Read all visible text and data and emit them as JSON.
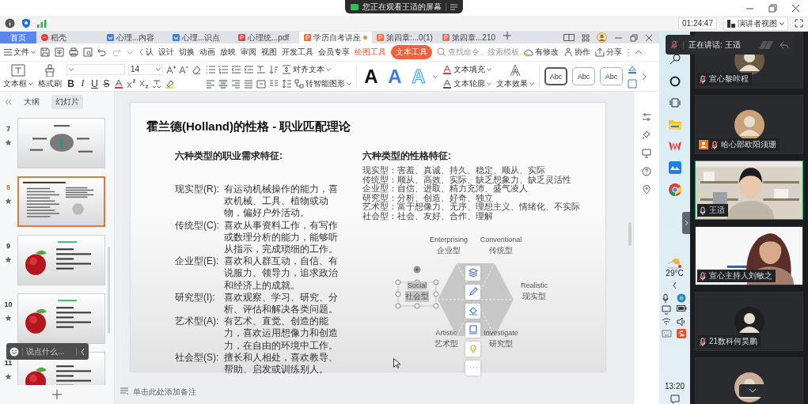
{
  "screen_share": {
    "notice": "您正在观看王适的屏幕"
  },
  "meeting_bar": {
    "timer": "01:24:47",
    "view_mode": "演讲者视图"
  },
  "wps": {
    "tabs": [
      {
        "label": "首页",
        "kind": "home",
        "selected": false,
        "modified": false
      },
      {
        "label": "稻壳",
        "kind": "docer",
        "selected": false,
        "modified": false
      },
      {
        "label": "心理...内容",
        "kind": "doc",
        "selected": false,
        "modified": false
      },
      {
        "label": "心理...识点",
        "kind": "doc",
        "selected": false,
        "modified": false
      },
      {
        "label": "心理统...pdf",
        "kind": "pdf",
        "selected": false,
        "modified": false
      },
      {
        "label": "学历自考讲座",
        "kind": "ppt",
        "selected": true,
        "modified": true
      },
      {
        "label": "第四章:...0(1)",
        "kind": "ppt",
        "selected": false,
        "modified": false
      },
      {
        "label": "第四章...210",
        "kind": "ppt",
        "selected": false,
        "modified": false
      }
    ],
    "menu": {
      "file": "文件",
      "scrolled_item": "认",
      "items": [
        "设计",
        "切换",
        "动画",
        "放映",
        "审阅",
        "视图",
        "开发工具",
        "会员专享"
      ],
      "tool_tabs": [
        {
          "label": "绘图工具",
          "selected": false
        },
        {
          "label": "文本工具",
          "selected": true
        }
      ],
      "search_placeholder": "查找命令、搜索模板",
      "actions": [
        {
          "label": "有修改",
          "kind": "cloud"
        },
        {
          "label": "协作",
          "kind": "collab"
        },
        {
          "label": "分享",
          "kind": "share"
        }
      ]
    },
    "ribbon": {
      "text_box": "文本框",
      "format_painter": "格式刷",
      "font_size": "14",
      "format_buttons": [
        {
          "label": "B",
          "kind": "bold"
        },
        {
          "label": "I",
          "kind": "italic"
        },
        {
          "label": "U",
          "kind": "underline"
        },
        {
          "label": "S",
          "kind": "strike"
        }
      ],
      "align_text": "对齐文本",
      "smart_art": "转智能图形",
      "art_letters": [
        {
          "letter": "A",
          "kind": "black"
        },
        {
          "letter": "A",
          "kind": "blue"
        },
        {
          "letter": "A",
          "kind": "outline"
        }
      ],
      "text_fill": "文本填充",
      "text_outline": "文本轮廓",
      "text_effect": "文本效果",
      "styles": [
        {
          "label": "Abc",
          "selected": true
        },
        {
          "label": "Abc",
          "selected": false
        },
        {
          "label": "Abc",
          "selected": false
        }
      ]
    },
    "slide_panel": {
      "tabs": [
        {
          "label": "大纲",
          "selected": false
        },
        {
          "label": "幻灯片",
          "selected": true
        }
      ],
      "slides": [
        {
          "number": "7",
          "kind": "photo-diagram",
          "selected": false
        },
        {
          "number": "8",
          "kind": "text-diagram",
          "selected": true
        },
        {
          "number": "9",
          "kind": "apple",
          "selected": false
        },
        {
          "number": "10",
          "kind": "apple",
          "selected": false
        },
        {
          "number": "11",
          "kind": "apple",
          "selected": false
        }
      ]
    },
    "slide": {
      "title": "霍兰德(Holland)的性格 - 职业匹配理论",
      "left_heading": "六种类型的职业需求特征:",
      "needs": [
        {
          "label": "现实型(R):",
          "text": "有运动机械操作的能力，喜欢机械、工具、植物或动物，偏好户外活动。"
        },
        {
          "label": "传统型(C):",
          "text": "喜欢从事资料工作，有写作或数理分析的能力，能够听从指示，完成琐细的工作。"
        },
        {
          "label": "企业型(E):",
          "text": "喜欢和人群互动，自信、有说服力、领导力，追求政治和经济上的成就。"
        },
        {
          "label": "研究型(I):",
          "text": "喜欢观察、学习、研究、分析、评估和解决各类问题。"
        },
        {
          "label": "艺术型(A):",
          "text": "有艺术、直觉、创造的能力，喜欢运用想像力和创造力，在自由的环境中工作。"
        },
        {
          "label": "社会型(S):",
          "text": "擅长和人相处，喜欢教导、帮助、启发或训练别人。"
        }
      ],
      "right_heading": "六种类型的性格特征:",
      "traits": [
        "现实型：害羞、真诚、持久、稳定、顺从、实际",
        "传统型：顺从、高效、实际、缺乏想象力、缺乏灵活性",
        "企业型：自信、进取、精力充沛、盛气凌人",
        "研究型：分析、创造、好奇、独立",
        "艺术型：富于想像力、无序、理想主义、情绪化、不实际",
        "社会型：社会、友好、合作、理解"
      ],
      "hexagon": [
        {
          "en": "Enterprising",
          "zh": "企业型",
          "selected": false
        },
        {
          "en": "Conventional",
          "zh": "传统型",
          "selected": false
        },
        {
          "en": "Social",
          "zh": "社会型",
          "selected": true
        },
        {
          "en": "Realistic",
          "zh": "现实型",
          "selected": false
        },
        {
          "en": "Artistic",
          "zh": "艺术型",
          "selected": false
        },
        {
          "en": "Investigate",
          "zh": "研究型",
          "selected": false
        }
      ]
    },
    "notes_placeholder": "单击此处添加备注",
    "chat": {
      "placeholder": "说点什么..."
    }
  },
  "taskbar": {
    "weather": "29°C",
    "clock": "13:20"
  },
  "meeting": {
    "speaking": "正在讲话: 王适",
    "participants": [
      {
        "name": "宣心黎咔程",
        "kind": "avatar",
        "muted": true,
        "badge": false,
        "speaking": false
      },
      {
        "name": "哈心部欧阳须珊",
        "kind": "avatar",
        "muted": true,
        "badge": true,
        "speaking": false
      },
      {
        "name": "王适",
        "kind": "video",
        "muted": false,
        "badge": false,
        "speaking": true
      },
      {
        "name": "宣心主持人刘敏之",
        "kind": "video",
        "muted": true,
        "badge": false,
        "speaking": false
      },
      {
        "name": "21数科何昊鹏",
        "kind": "avatar",
        "muted": true,
        "badge": false,
        "speaking": false
      },
      {
        "kind": "avatar",
        "speaking": false
      }
    ]
  }
}
